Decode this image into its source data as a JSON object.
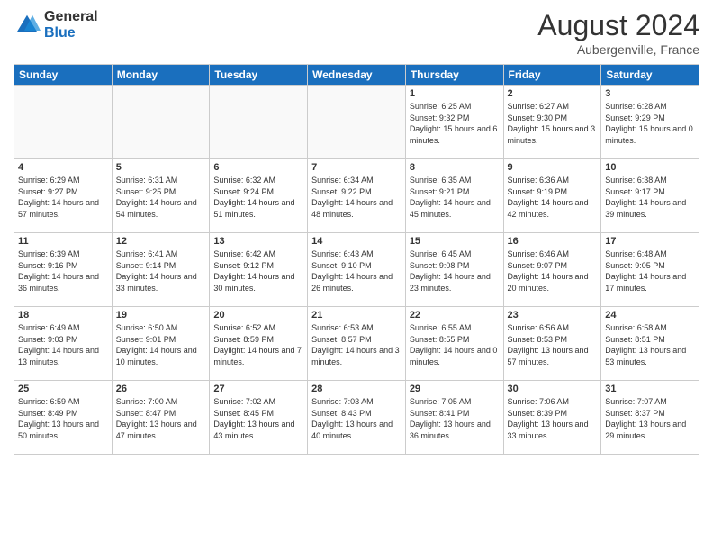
{
  "header": {
    "logo_general": "General",
    "logo_blue": "Blue",
    "month_year": "August 2024",
    "location": "Aubergenville, France"
  },
  "days_of_week": [
    "Sunday",
    "Monday",
    "Tuesday",
    "Wednesday",
    "Thursday",
    "Friday",
    "Saturday"
  ],
  "weeks": [
    [
      {
        "day": "",
        "sunrise": "",
        "sunset": "",
        "daylight": ""
      },
      {
        "day": "",
        "sunrise": "",
        "sunset": "",
        "daylight": ""
      },
      {
        "day": "",
        "sunrise": "",
        "sunset": "",
        "daylight": ""
      },
      {
        "day": "",
        "sunrise": "",
        "sunset": "",
        "daylight": ""
      },
      {
        "day": "1",
        "sunrise": "Sunrise: 6:25 AM",
        "sunset": "Sunset: 9:32 PM",
        "daylight": "Daylight: 15 hours and 6 minutes."
      },
      {
        "day": "2",
        "sunrise": "Sunrise: 6:27 AM",
        "sunset": "Sunset: 9:30 PM",
        "daylight": "Daylight: 15 hours and 3 minutes."
      },
      {
        "day": "3",
        "sunrise": "Sunrise: 6:28 AM",
        "sunset": "Sunset: 9:29 PM",
        "daylight": "Daylight: 15 hours and 0 minutes."
      }
    ],
    [
      {
        "day": "4",
        "sunrise": "Sunrise: 6:29 AM",
        "sunset": "Sunset: 9:27 PM",
        "daylight": "Daylight: 14 hours and 57 minutes."
      },
      {
        "day": "5",
        "sunrise": "Sunrise: 6:31 AM",
        "sunset": "Sunset: 9:25 PM",
        "daylight": "Daylight: 14 hours and 54 minutes."
      },
      {
        "day": "6",
        "sunrise": "Sunrise: 6:32 AM",
        "sunset": "Sunset: 9:24 PM",
        "daylight": "Daylight: 14 hours and 51 minutes."
      },
      {
        "day": "7",
        "sunrise": "Sunrise: 6:34 AM",
        "sunset": "Sunset: 9:22 PM",
        "daylight": "Daylight: 14 hours and 48 minutes."
      },
      {
        "day": "8",
        "sunrise": "Sunrise: 6:35 AM",
        "sunset": "Sunset: 9:21 PM",
        "daylight": "Daylight: 14 hours and 45 minutes."
      },
      {
        "day": "9",
        "sunrise": "Sunrise: 6:36 AM",
        "sunset": "Sunset: 9:19 PM",
        "daylight": "Daylight: 14 hours and 42 minutes."
      },
      {
        "day": "10",
        "sunrise": "Sunrise: 6:38 AM",
        "sunset": "Sunset: 9:17 PM",
        "daylight": "Daylight: 14 hours and 39 minutes."
      }
    ],
    [
      {
        "day": "11",
        "sunrise": "Sunrise: 6:39 AM",
        "sunset": "Sunset: 9:16 PM",
        "daylight": "Daylight: 14 hours and 36 minutes."
      },
      {
        "day": "12",
        "sunrise": "Sunrise: 6:41 AM",
        "sunset": "Sunset: 9:14 PM",
        "daylight": "Daylight: 14 hours and 33 minutes."
      },
      {
        "day": "13",
        "sunrise": "Sunrise: 6:42 AM",
        "sunset": "Sunset: 9:12 PM",
        "daylight": "Daylight: 14 hours and 30 minutes."
      },
      {
        "day": "14",
        "sunrise": "Sunrise: 6:43 AM",
        "sunset": "Sunset: 9:10 PM",
        "daylight": "Daylight: 14 hours and 26 minutes."
      },
      {
        "day": "15",
        "sunrise": "Sunrise: 6:45 AM",
        "sunset": "Sunset: 9:08 PM",
        "daylight": "Daylight: 14 hours and 23 minutes."
      },
      {
        "day": "16",
        "sunrise": "Sunrise: 6:46 AM",
        "sunset": "Sunset: 9:07 PM",
        "daylight": "Daylight: 14 hours and 20 minutes."
      },
      {
        "day": "17",
        "sunrise": "Sunrise: 6:48 AM",
        "sunset": "Sunset: 9:05 PM",
        "daylight": "Daylight: 14 hours and 17 minutes."
      }
    ],
    [
      {
        "day": "18",
        "sunrise": "Sunrise: 6:49 AM",
        "sunset": "Sunset: 9:03 PM",
        "daylight": "Daylight: 14 hours and 13 minutes."
      },
      {
        "day": "19",
        "sunrise": "Sunrise: 6:50 AM",
        "sunset": "Sunset: 9:01 PM",
        "daylight": "Daylight: 14 hours and 10 minutes."
      },
      {
        "day": "20",
        "sunrise": "Sunrise: 6:52 AM",
        "sunset": "Sunset: 8:59 PM",
        "daylight": "Daylight: 14 hours and 7 minutes."
      },
      {
        "day": "21",
        "sunrise": "Sunrise: 6:53 AM",
        "sunset": "Sunset: 8:57 PM",
        "daylight": "Daylight: 14 hours and 3 minutes."
      },
      {
        "day": "22",
        "sunrise": "Sunrise: 6:55 AM",
        "sunset": "Sunset: 8:55 PM",
        "daylight": "Daylight: 14 hours and 0 minutes."
      },
      {
        "day": "23",
        "sunrise": "Sunrise: 6:56 AM",
        "sunset": "Sunset: 8:53 PM",
        "daylight": "Daylight: 13 hours and 57 minutes."
      },
      {
        "day": "24",
        "sunrise": "Sunrise: 6:58 AM",
        "sunset": "Sunset: 8:51 PM",
        "daylight": "Daylight: 13 hours and 53 minutes."
      }
    ],
    [
      {
        "day": "25",
        "sunrise": "Sunrise: 6:59 AM",
        "sunset": "Sunset: 8:49 PM",
        "daylight": "Daylight: 13 hours and 50 minutes."
      },
      {
        "day": "26",
        "sunrise": "Sunrise: 7:00 AM",
        "sunset": "Sunset: 8:47 PM",
        "daylight": "Daylight: 13 hours and 47 minutes."
      },
      {
        "day": "27",
        "sunrise": "Sunrise: 7:02 AM",
        "sunset": "Sunset: 8:45 PM",
        "daylight": "Daylight: 13 hours and 43 minutes."
      },
      {
        "day": "28",
        "sunrise": "Sunrise: 7:03 AM",
        "sunset": "Sunset: 8:43 PM",
        "daylight": "Daylight: 13 hours and 40 minutes."
      },
      {
        "day": "29",
        "sunrise": "Sunrise: 7:05 AM",
        "sunset": "Sunset: 8:41 PM",
        "daylight": "Daylight: 13 hours and 36 minutes."
      },
      {
        "day": "30",
        "sunrise": "Sunrise: 7:06 AM",
        "sunset": "Sunset: 8:39 PM",
        "daylight": "Daylight: 13 hours and 33 minutes."
      },
      {
        "day": "31",
        "sunrise": "Sunrise: 7:07 AM",
        "sunset": "Sunset: 8:37 PM",
        "daylight": "Daylight: 13 hours and 29 minutes."
      }
    ]
  ]
}
